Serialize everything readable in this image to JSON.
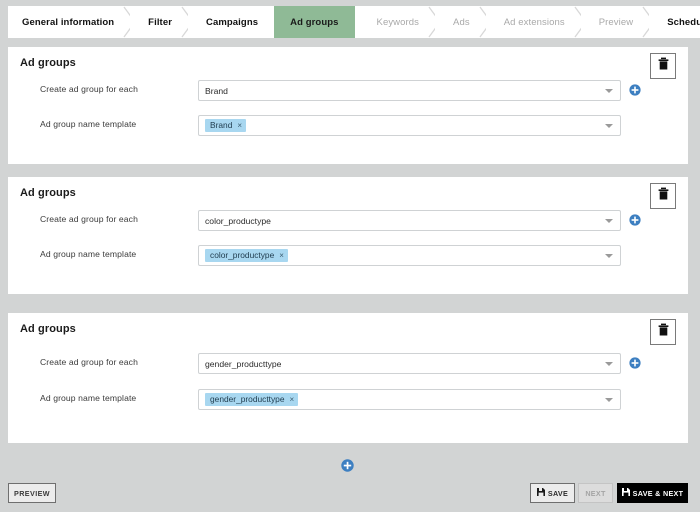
{
  "wizard": {
    "tabs": [
      {
        "label": "General information",
        "state": "done"
      },
      {
        "label": "Filter",
        "state": "done"
      },
      {
        "label": "Campaigns",
        "state": "done"
      },
      {
        "label": "Ad groups",
        "state": "active"
      },
      {
        "label": "Keywords",
        "state": "upcoming"
      },
      {
        "label": "Ads",
        "state": "upcoming"
      },
      {
        "label": "Ad extensions",
        "state": "upcoming"
      },
      {
        "label": "Preview",
        "state": "upcoming"
      },
      {
        "label": "Scheduling",
        "state": "done"
      }
    ]
  },
  "cards": [
    {
      "title": "Ad groups",
      "create_label": "Create ad group for each",
      "create_value": "Brand",
      "template_label": "Ad group name template",
      "template_chip": "Brand",
      "chip_remove": "×"
    },
    {
      "title": "Ad groups",
      "create_label": "Create ad group for each",
      "create_value": "color_productype",
      "template_label": "Ad group name template",
      "template_chip": "color_productype",
      "chip_remove": "×"
    },
    {
      "title": "Ad groups",
      "create_label": "Create ad group for each",
      "create_value": "gender_producttype",
      "template_label": "Ad group name template",
      "template_chip": "gender_producttype",
      "chip_remove": "×"
    }
  ],
  "icons": {
    "trash": "trash-icon",
    "add": "plus-circle-icon",
    "save": "floppy-disk-icon",
    "dropdown": "caret-down-icon"
  },
  "colors": {
    "page_background": "#d2d4d4",
    "card_background": "#ffffff",
    "active_tab": "#8fba96",
    "accent_blue": "#3d7fc1",
    "chip_background": "#a8d7f0",
    "primary_button": "#000000"
  },
  "footer": {
    "preview_label": "PREVIEW",
    "save_label": "SAVE",
    "next_label": "NEXT",
    "save_next_label": "SAVE & NEXT"
  }
}
